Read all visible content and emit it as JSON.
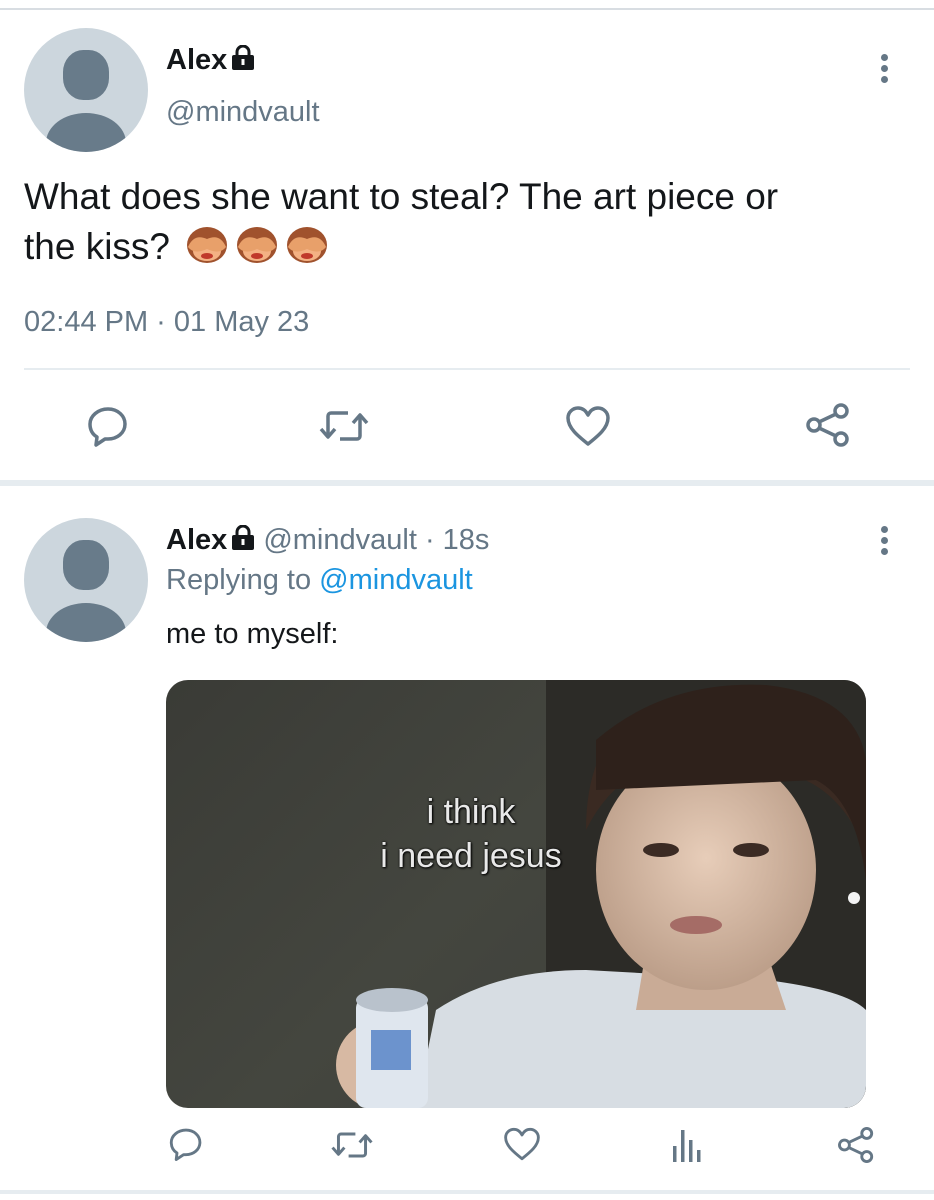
{
  "tweet": {
    "name": "Alex",
    "handle": "@mindvault",
    "text_line1": "What does she want to steal? The art piece or",
    "text_line2": "the kiss?",
    "emoji_icons": [
      "see-no-evil-monkey-icon",
      "see-no-evil-monkey-icon",
      "see-no-evil-monkey-icon"
    ],
    "timestamp": "02:44 PM · 01 May 23"
  },
  "reply": {
    "name": "Alex",
    "handle_time": "@mindvault · 18s",
    "replying_prefix": "Replying to",
    "replying_handle": "@mindvault",
    "text": "me to myself:",
    "media_caption_line1": "i think",
    "media_caption_line2": "i need jesus"
  },
  "colors": {
    "link": "#1b95e0",
    "secondary_text": "#657786",
    "avatar_bg": "#ccd6dd",
    "avatar_fg": "#687b8a",
    "divider": "#e6ecf0"
  }
}
